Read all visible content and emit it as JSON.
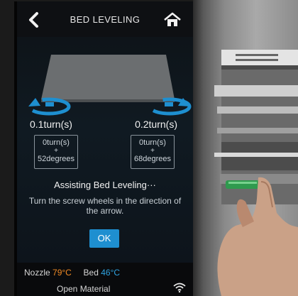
{
  "header": {
    "title": "BED LEVELING",
    "back_icon": "back-arrow-icon",
    "home_icon": "home-icon"
  },
  "leveling": {
    "left_turns": "0.1turn(s)",
    "right_turns": "0.2turn(s)",
    "left_box": {
      "turns": "0turn(s)",
      "plus": "+",
      "degrees": "52degrees"
    },
    "right_box": {
      "turns": "0turn(s)",
      "plus": "+",
      "degrees": "68degrees"
    },
    "status_text": "Assisting Bed Leveling···",
    "instruction": "Turn the screw wheels in the direction of the arrow.",
    "ok_label": "OK"
  },
  "status_bar": {
    "nozzle_label": "Nozzle",
    "nozzle_temp": "79°C",
    "bed_label": "Bed",
    "bed_temp": "46°C",
    "open_material": "Open Material",
    "wifi_icon": "wifi-icon"
  },
  "colors": {
    "accent": "#1e8fd0",
    "nozzle": "#f08a24",
    "bed": "#2fa3e0"
  }
}
